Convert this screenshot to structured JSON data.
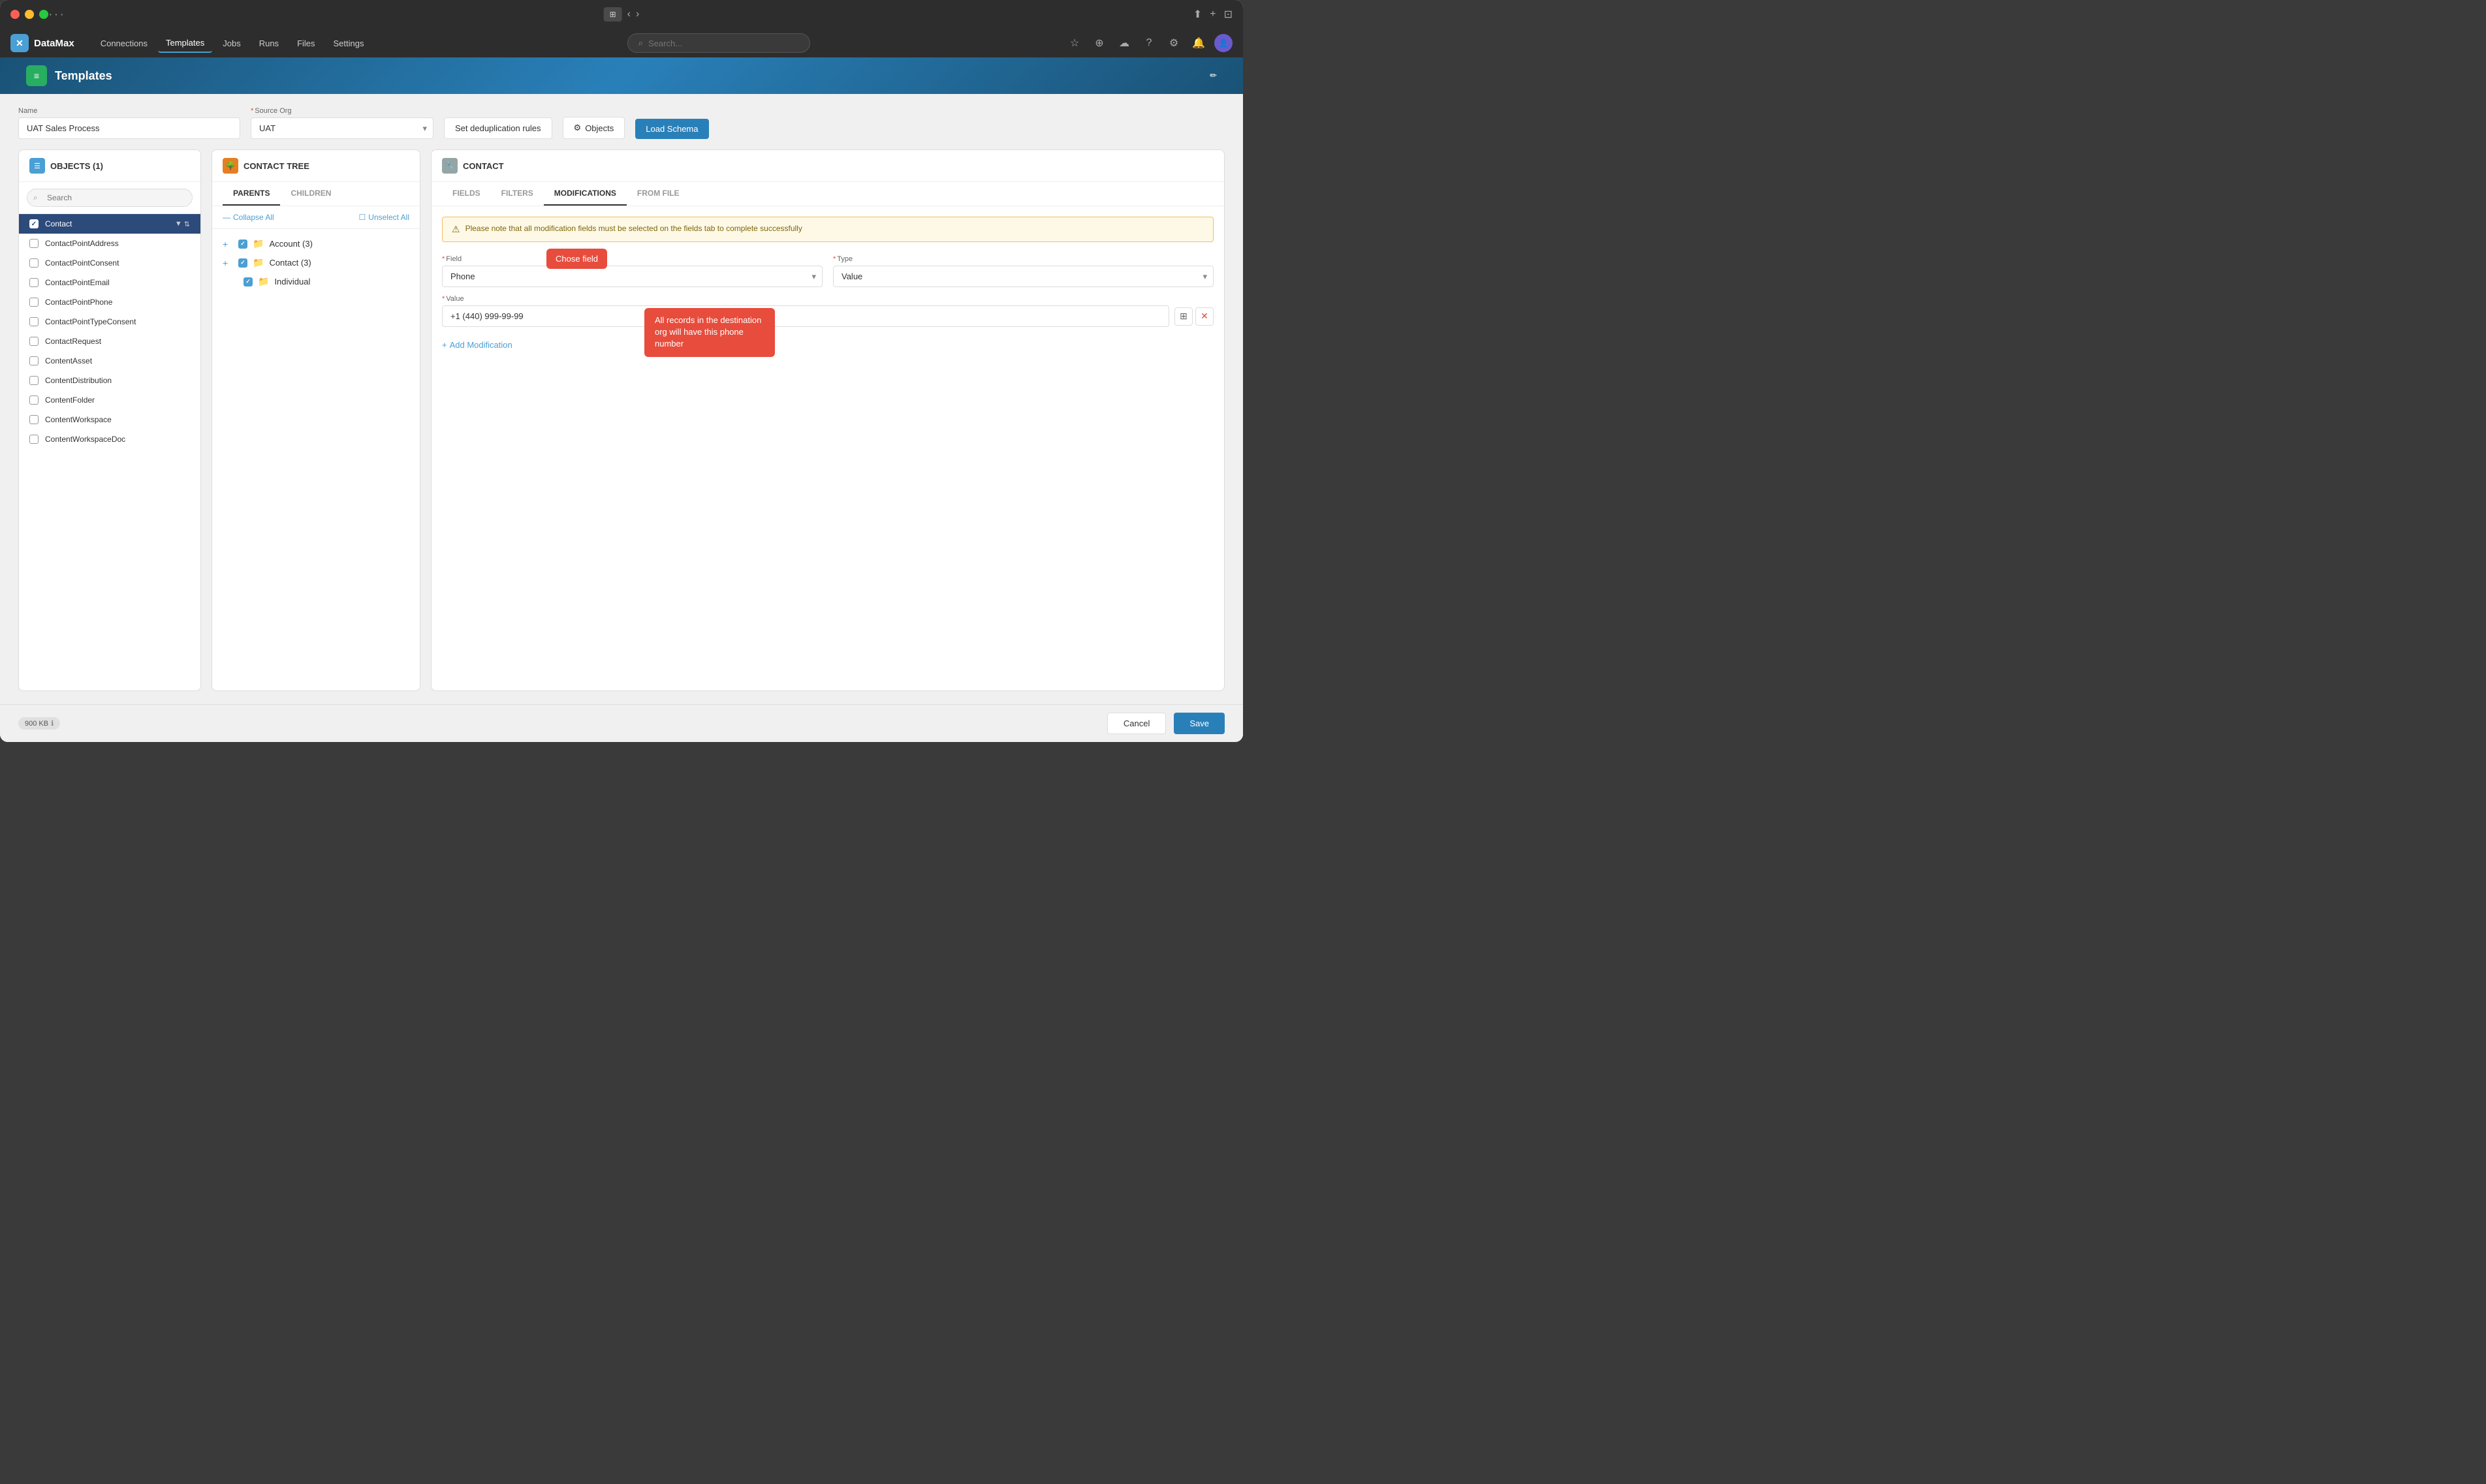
{
  "window": {
    "title": "DataMax",
    "dots": "···"
  },
  "titlebar": {
    "window_btns": [
      "⊞",
      "↗",
      "+"
    ]
  },
  "navbar": {
    "app_name": "DataMax",
    "links": [
      {
        "id": "connections",
        "label": "Connections",
        "active": false
      },
      {
        "id": "templates",
        "label": "Templates",
        "active": true
      },
      {
        "id": "jobs",
        "label": "Jobs",
        "active": false
      },
      {
        "id": "runs",
        "label": "Runs",
        "active": false
      },
      {
        "id": "files",
        "label": "Files",
        "active": false
      },
      {
        "id": "settings",
        "label": "Settings",
        "active": false
      }
    ],
    "search_placeholder": "Search..."
  },
  "page_header": {
    "title": "Templates"
  },
  "form": {
    "name_label": "Name",
    "name_value": "UAT Sales Process",
    "source_org_label": "Source Org",
    "source_org_value": "UAT",
    "dedup_btn": "Set deduplication rules",
    "objects_btn": "Objects",
    "load_schema_btn": "Load Schema"
  },
  "objects_panel": {
    "title": "OBJECTS (1)",
    "search_placeholder": "Search",
    "items": [
      {
        "id": "contact",
        "label": "Contact",
        "selected": true,
        "has_icons": true
      },
      {
        "id": "contact-point-address",
        "label": "ContactPointAddress",
        "selected": false
      },
      {
        "id": "contact-point-consent",
        "label": "ContactPointConsent",
        "selected": false
      },
      {
        "id": "contact-point-email",
        "label": "ContactPointEmail",
        "selected": false
      },
      {
        "id": "contact-point-phone",
        "label": "ContactPointPhone",
        "selected": false
      },
      {
        "id": "contact-point-type-consent",
        "label": "ContactPointTypeConsent",
        "selected": false
      },
      {
        "id": "contact-request",
        "label": "ContactRequest",
        "selected": false
      },
      {
        "id": "content-asset",
        "label": "ContentAsset",
        "selected": false
      },
      {
        "id": "content-distribution",
        "label": "ContentDistribution",
        "selected": false
      },
      {
        "id": "content-folder",
        "label": "ContentFolder",
        "selected": false
      },
      {
        "id": "content-workspace",
        "label": "ContentWorkspace",
        "selected": false
      },
      {
        "id": "content-workspace-doc",
        "label": "ContentWorkspaceDoc",
        "selected": false
      }
    ]
  },
  "contact_tree": {
    "title": "CONTACT TREE",
    "tabs": [
      {
        "id": "parents",
        "label": "PARENTS",
        "active": true
      },
      {
        "id": "children",
        "label": "CHILDREN",
        "active": false
      }
    ],
    "collapse_all": "Collapse All",
    "unselect_all": "Unselect All",
    "items": [
      {
        "id": "account",
        "label": "Account (3)",
        "checked": true,
        "level": 0,
        "expandable": true
      },
      {
        "id": "contact",
        "label": "Contact (3)",
        "checked": true,
        "level": 0,
        "expandable": true
      },
      {
        "id": "individual",
        "label": "Individual",
        "checked": true,
        "level": 1,
        "expandable": false
      }
    ]
  },
  "modifications": {
    "panel_title": "CONTACT",
    "tabs": [
      {
        "id": "fields",
        "label": "FIELDS",
        "active": false
      },
      {
        "id": "filters",
        "label": "FILTERS",
        "active": false
      },
      {
        "id": "modifications",
        "label": "MODIFICATIONS",
        "active": true
      },
      {
        "id": "from-file",
        "label": "FROM FILE",
        "active": false
      }
    ],
    "alert_text": "Please note that all modification fields must be selected on the fields tab to complete successfully",
    "field_label": "Field",
    "field_value": "Phone",
    "type_label": "Type",
    "type_value": "Value",
    "value_label": "Value",
    "value_placeholder": "+1 (440) 999-99-99",
    "add_modification": "Add Modification",
    "tooltip_chose_field": "Chose field",
    "tooltip_phone_info": "All records in the destination org will have this phone number"
  },
  "footer": {
    "size_badge": "900 KB",
    "cancel_btn": "Cancel",
    "save_btn": "Save"
  }
}
